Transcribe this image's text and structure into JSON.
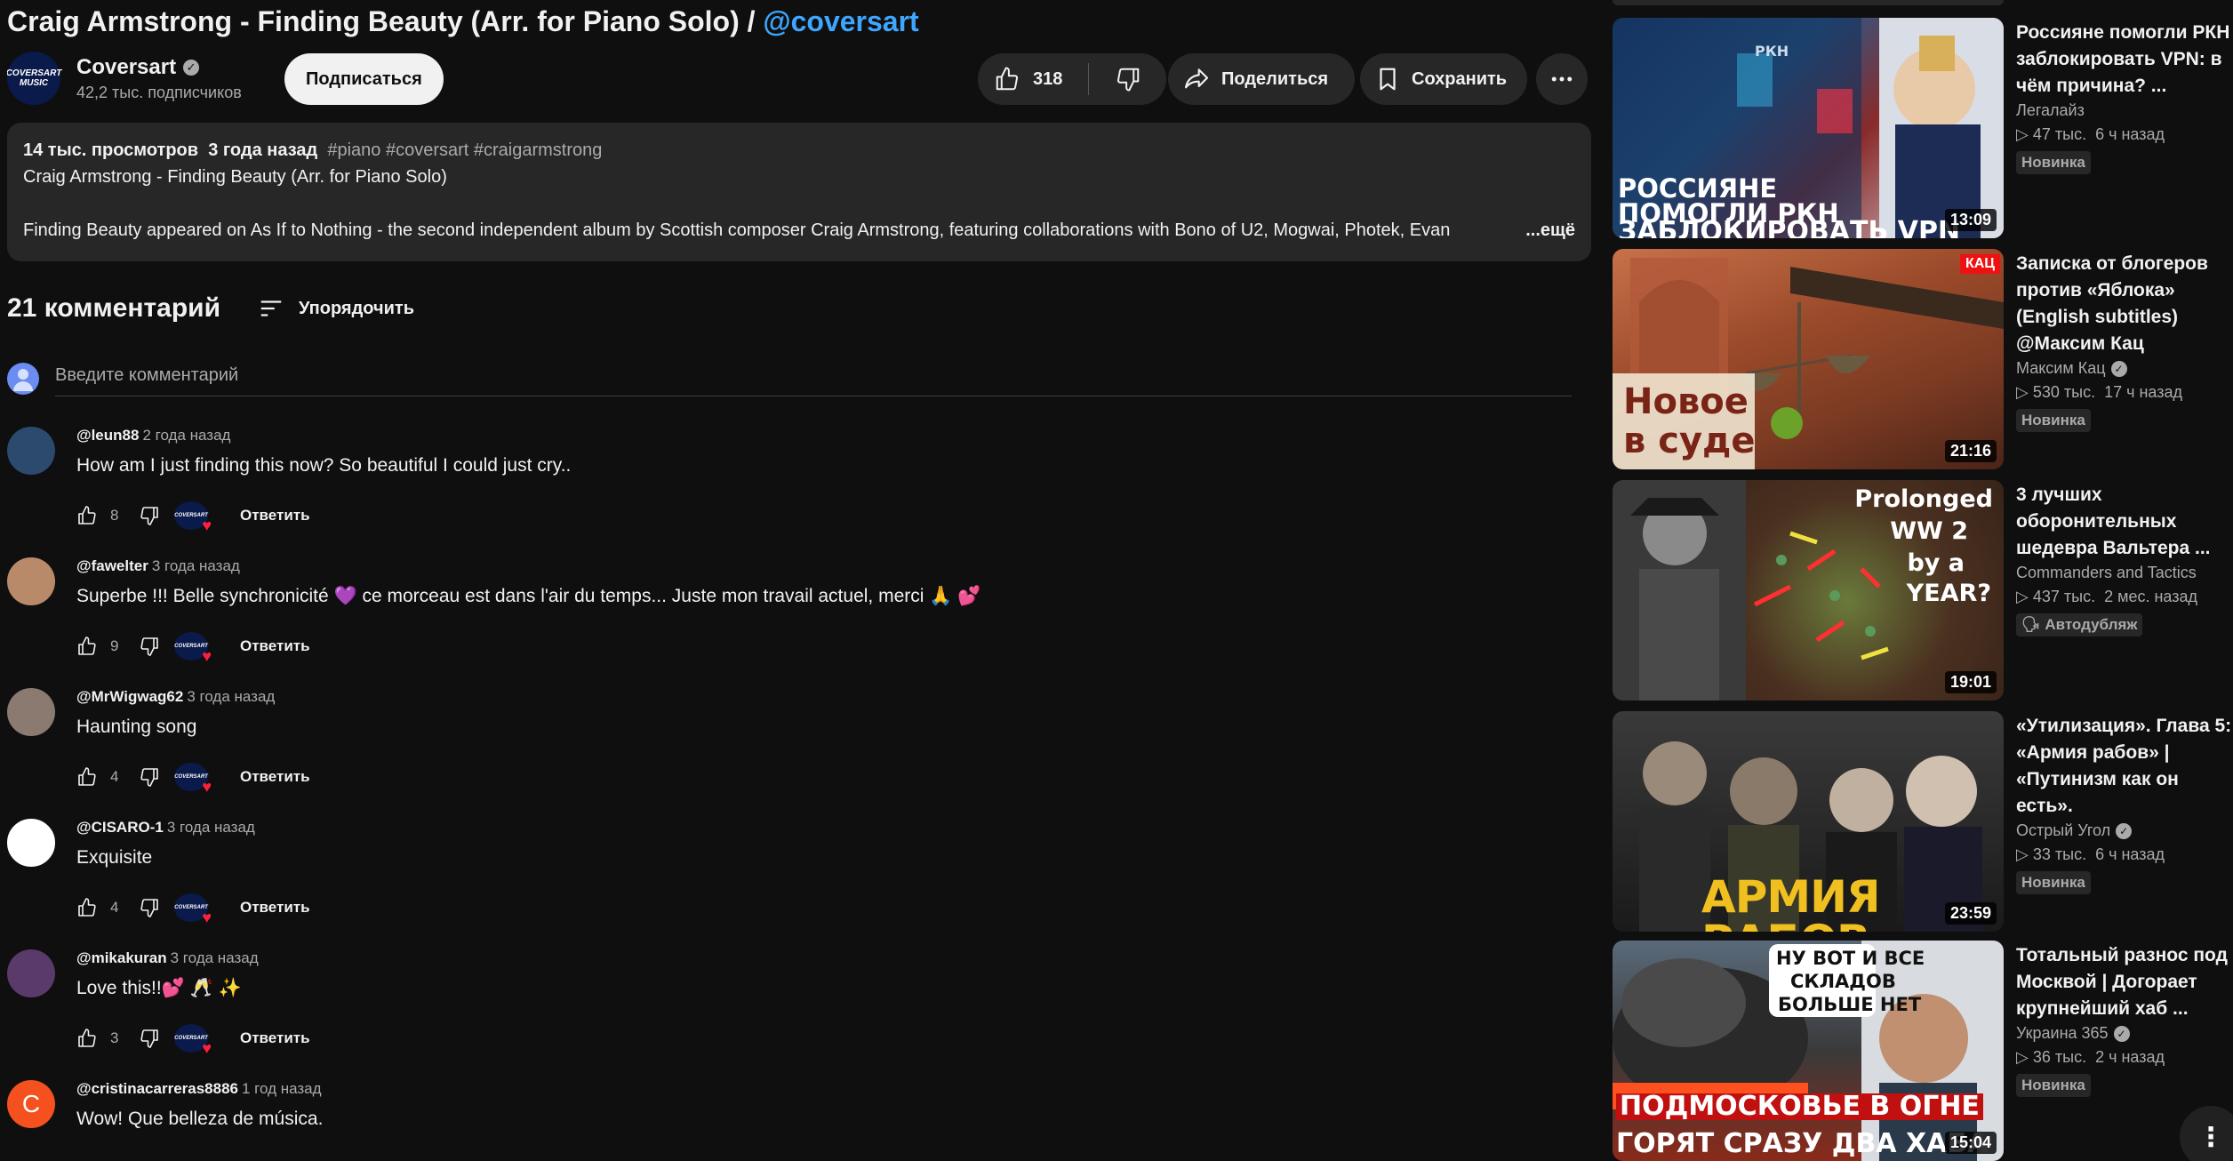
{
  "video": {
    "title": "Craig Armstrong - Finding Beauty (Arr. for Piano Solo) / ",
    "title_tag": "@coversart"
  },
  "channel": {
    "avatar_text": "COVERSART MUSIC",
    "name": "Coversart",
    "subscribers": "42,2 тыс. подписчиков",
    "subscribe_label": "Подписаться"
  },
  "actions": {
    "likes": "318",
    "share_label": "Поделиться",
    "save_label": "Сохранить"
  },
  "description": {
    "views": "14 тыс. просмотров",
    "date": "3 года назад",
    "hashtags": "#piano #coversart #craigarmstrong",
    "line1": "Craig Armstrong - Finding Beauty  (Arr. for Piano Solo)",
    "line2": "Finding Beauty appeared on As If to Nothing - the second independent album by Scottish composer Craig Armstrong, featuring collaborations with Bono of U2, Mogwai, Photek, Evan",
    "more_label": "...ещё"
  },
  "comments_section": {
    "count_label": "21 комментарий",
    "sort_label": "Упорядочить",
    "input_placeholder": "Введите комментарий",
    "reply_label": "Ответить",
    "heart_avatar_text": "COVERSART",
    "items": [
      {
        "author": "@leun88",
        "time": "2 года назад",
        "text": "How am I just finding this now? So beautiful I could just cry..",
        "likes": "8",
        "avatar_color": "#2c4a6e",
        "avatar_letter": ""
      },
      {
        "author": "@fawelter",
        "time": "3 года назад",
        "text": "Superbe !!! Belle synchronicité 💜 ce morceau est dans l'air du temps... Juste mon travail actuel, merci 🙏 💕",
        "likes": "9",
        "avatar_color": "#b98a6a",
        "avatar_letter": ""
      },
      {
        "author": "@MrWigwag62",
        "time": "3 года назад",
        "text": "Haunting song",
        "likes": "4",
        "avatar_color": "#8a7a70",
        "avatar_letter": ""
      },
      {
        "author": "@CISARO-1",
        "time": "3 года назад",
        "text": "Exquisite",
        "likes": "4",
        "avatar_color": "#ffffff",
        "avatar_letter": ""
      },
      {
        "author": "@mikakuran",
        "time": "3 года назад",
        "text": "Love this!!💕 🥂 ✨",
        "likes": "3",
        "avatar_color": "#5a3a6a",
        "avatar_letter": ""
      },
      {
        "author": "@cristinacarreras8886",
        "time": "1 год назад",
        "text": "Wow! Que belleza de música.",
        "likes": "",
        "avatar_color": "#f4511e",
        "avatar_letter": "C"
      }
    ]
  },
  "recommended": [
    {
      "title": "Россияне помогли РКН заблокировать VPN: в чём причина? ...",
      "channel": "Легалайз",
      "verified": false,
      "views": "47 тыс.",
      "age": "6 ч назад",
      "badge": "Новинка",
      "duration": "13:09",
      "thumb_caption_1": "РОССИЯНЕ",
      "thumb_caption_2": "ПОМОГЛИ РКН",
      "thumb_caption_3": "ЗАБЛОКИРОВАТЬ VPN",
      "thumb_small": "РКН"
    },
    {
      "title": "Записка от блогеров против «Яблока» (English subtitles) @Максим Кац",
      "channel": "Максим Кац",
      "verified": true,
      "views": "530 тыс.",
      "age": "17 ч назад",
      "badge": "Новинка",
      "duration": "21:16",
      "thumb_caption_1": "Новое",
      "thumb_caption_2": "в суде",
      "thumb_small": "КАЦ"
    },
    {
      "title": "3 лучших оборонительных шедевра Вальтера ...",
      "channel": "Commanders and Tactics",
      "verified": false,
      "views": "437 тыс.",
      "age": "2 мес. назад",
      "badge": "Автодубляж",
      "duration": "19:01",
      "thumb_caption_1": "Prolonged",
      "thumb_caption_2": "WW 2",
      "thumb_caption_3": "by a",
      "thumb_caption_4": "YEAR?"
    },
    {
      "title": "«Утилизация». Глава 5: «Армия рабов» | «Путинизм как он есть».",
      "channel": "Острый Угол",
      "verified": true,
      "views": "33 тыс.",
      "age": "6 ч назад",
      "badge": "Новинка",
      "duration": "23:59",
      "thumb_caption_1": "АРМИЯ РАБОВ"
    },
    {
      "title": "Тотальный разнос под Москвой | Догорает крупнейший хаб ...",
      "channel": "Украина 365",
      "verified": true,
      "views": "36 тыс.",
      "age": "2 ч назад",
      "badge": "Новинка",
      "duration": "15:04",
      "thumb_caption_1": "НУ ВОТ И ВСЕ",
      "thumb_caption_2": "СКЛАДОВ",
      "thumb_caption_3": "БОЛЬШЕ НЕТ",
      "thumb_caption_4": "ПОДМОСКОВЬЕ В ОГНЕ",
      "thumb_caption_5": "ГОРЯТ СРАЗУ ДВА ХАБА"
    }
  ],
  "colors": {
    "background": "#0f0f0f",
    "surface": "#272727",
    "link": "#3ea6ff",
    "heart": "#ff1f3d"
  }
}
